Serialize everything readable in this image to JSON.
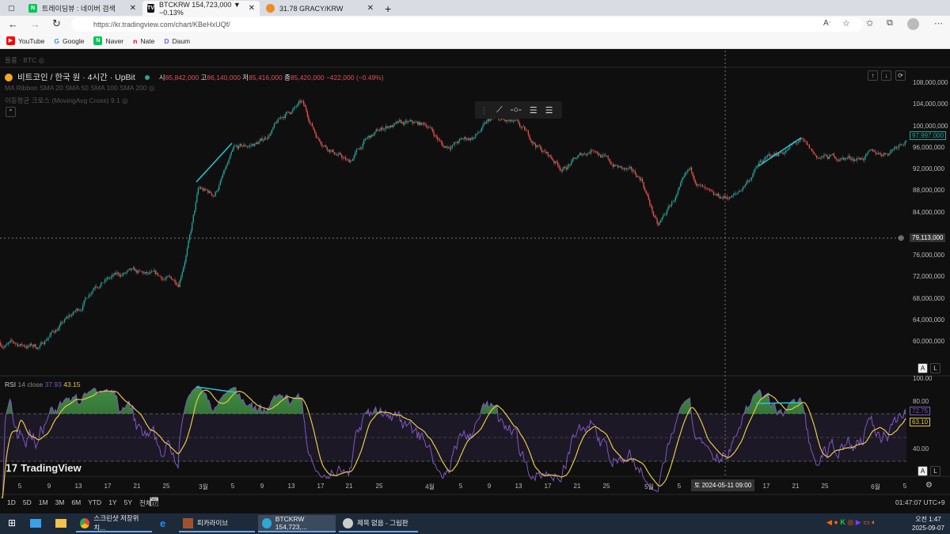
{
  "browser": {
    "tabs": [
      {
        "label": "트레이딩뷰 : 네이버 검색",
        "icon": "naver-icon"
      },
      {
        "label": "BTCKRW 154,723,000 ▼ −0.13%",
        "icon": "tradingview-icon"
      },
      {
        "label": "31.78 GRACY/KRW",
        "icon": "gracy-icon"
      }
    ],
    "url": "https://kr.tradingview.com/chart/KBeHxUQf/",
    "bookmarks": [
      "YouTube",
      "Google",
      "Naver",
      "Nate",
      "Daum"
    ]
  },
  "chart": {
    "volume_legend": "볼륨 · BTC",
    "symbol": "비트코인 / 한국 원 · 4시간 · UpBit",
    "ohlc": {
      "o_label": "시",
      "o": "85,842,000",
      "h_label": "고",
      "h": "86,140,000",
      "l_label": "저",
      "l": "85,416,000",
      "c_label": "종",
      "c": "85,420,000",
      "change": "−422,000 (−0.49%)"
    },
    "indicator1": "MA Ribbon SMA 20 SMA 50 SMA 100 SMA 200",
    "indicator2": "이동평균 크로스 (MovingAvg Cross) 9 1",
    "price_axis": [
      "108,000,000",
      "104,000,000",
      "100,000,000",
      "96,000,000",
      "92,000,000",
      "88,000,000",
      "84,000,000",
      "76,000,000",
      "72,000,000",
      "68,000,000",
      "64,000,000",
      "60,000,000"
    ],
    "last_price": "97,997,000",
    "crosshair_price": "79,113,000",
    "rsi": {
      "label": "RSI",
      "params": "14 close",
      "value": "37.93",
      "ma_value": "43.15",
      "axis": [
        "100.00",
        "80.00",
        "40.00"
      ],
      "last": "72.75",
      "last_ma": "63.10"
    },
    "time_axis": [
      [
        "5",
        25
      ],
      [
        "9",
        62
      ],
      [
        "13",
        99
      ],
      [
        "17",
        136
      ],
      [
        "21",
        173
      ],
      [
        "25",
        210
      ],
      [
        "3월",
        257
      ],
      [
        "5",
        294
      ],
      [
        "9",
        331
      ],
      [
        "13",
        368
      ],
      [
        "17",
        405
      ],
      [
        "21",
        441
      ],
      [
        "25",
        479
      ],
      [
        "4월",
        543
      ],
      [
        "5",
        582
      ],
      [
        "9",
        618
      ],
      [
        "13",
        655
      ],
      [
        "17",
        692
      ],
      [
        "21",
        729
      ],
      [
        "25",
        766
      ],
      [
        "5월",
        820
      ],
      [
        "5",
        858
      ],
      [
        "17",
        968
      ],
      [
        "21",
        1005
      ],
      [
        "25",
        1042
      ],
      [
        "6월",
        1106
      ],
      [
        "5",
        1143
      ]
    ],
    "crosshair_time": "토 2024-05-11  09:00",
    "brand": "TradingView",
    "ranges": [
      "1D",
      "5D",
      "1M",
      "3M",
      "6M",
      "YTD",
      "1Y",
      "5Y",
      "전체"
    ],
    "clock": "01:47:07 UTC+9",
    "colors": {
      "up": "#26a69a",
      "down": "#ef5350",
      "rsi": "#7e57c2",
      "rsi_ma": "#e6c84a",
      "trend": "#26c6da"
    }
  },
  "chart_data": {
    "type": "candlestick",
    "ylim": [
      58000000,
      110000000
    ],
    "price_path_day_price": [
      [
        2.3,
        59.5
      ],
      [
        7.7,
        59
      ],
      [
        8.8,
        61
      ],
      [
        13.1,
        66
      ],
      [
        15.2,
        71
      ],
      [
        19.5,
        72.5
      ],
      [
        26.5,
        71
      ],
      [
        28.1,
        80
      ],
      [
        29.2,
        88
      ],
      [
        31.3,
        87
      ],
      [
        34,
        95
      ],
      [
        37.8,
        97
      ],
      [
        41,
        102
      ],
      [
        43.2,
        104
      ],
      [
        45.3,
        98
      ],
      [
        49.6,
        93
      ],
      [
        51.8,
        97
      ],
      [
        55,
        100
      ],
      [
        60.4,
        100
      ],
      [
        62.5,
        96
      ],
      [
        66.8,
        98
      ],
      [
        69,
        101
      ],
      [
        72.2,
        100
      ],
      [
        75.4,
        96
      ],
      [
        78.7,
        92
      ],
      [
        83,
        96
      ],
      [
        85.1,
        93
      ],
      [
        89.4,
        90
      ],
      [
        91.6,
        81
      ],
      [
        93.7,
        86
      ],
      [
        95.9,
        91
      ],
      [
        99.1,
        86
      ],
      [
        102.3,
        87
      ],
      [
        105.5,
        93
      ],
      [
        110.9,
        97
      ],
      [
        113.1,
        94
      ],
      [
        118.4,
        94
      ],
      [
        122.7,
        95
      ],
      [
        125.4,
        98
      ]
    ]
  },
  "taskbar": {
    "items": [
      "스크린샷 저장위치...",
      "피카라이브",
      "BTCKRW 154,723,...",
      "제목 없음 - 그림판"
    ],
    "time": "오전 1:47",
    "date": "2025-09-07"
  }
}
